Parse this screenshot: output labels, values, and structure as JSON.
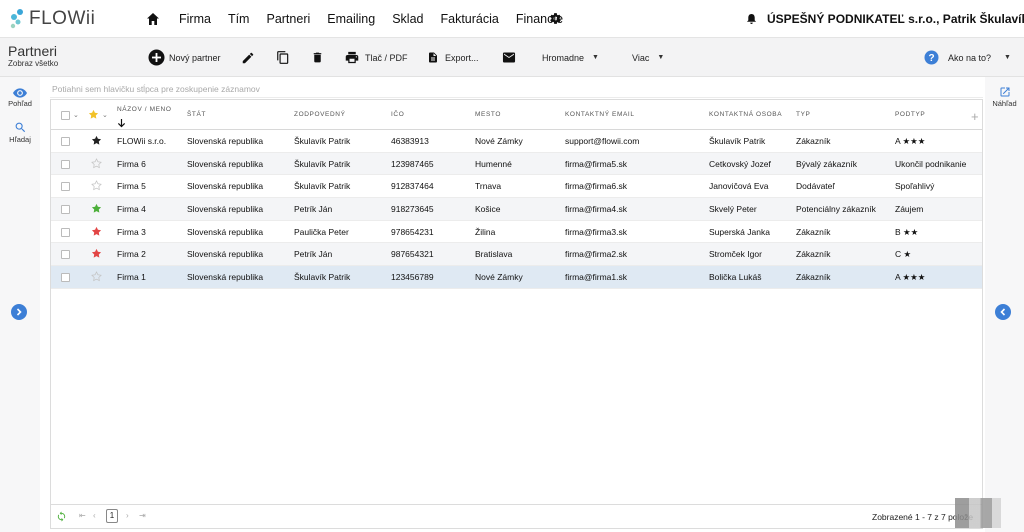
{
  "app": {
    "logo_text": "FLOWii"
  },
  "nav": {
    "items": [
      "Firma",
      "Tím",
      "Partneri",
      "Emailing",
      "Sklad",
      "Fakturácia",
      "Financie"
    ],
    "company": "ÚSPEŠNÝ PODNIKATEĽ s.r.o., Patrik Škulavík"
  },
  "page": {
    "title": "Partneri",
    "subtitle": "Zobraz všetko"
  },
  "toolbar": {
    "new_partner": "Nový partner",
    "print": "Tlač / PDF",
    "export": "Export...",
    "bulk": "Hromadne",
    "more": "Viac",
    "help": "Ako na to?"
  },
  "left_rail": {
    "view": "Pohľad",
    "search": "Hľadaj"
  },
  "right_rail": {
    "preview": "Náhľad"
  },
  "grid": {
    "group_hint": "Potiahni sem hlavičku stĺpca pre zoskupenie záznamov",
    "columns": [
      "NÁZOV / MENO",
      "ŠTÁT",
      "ZODPOVEDNÝ",
      "IČO",
      "MESTO",
      "KONTAKTNÝ EMAIL",
      "KONTAKTNÁ OSOBA",
      "TYP",
      "PODTYP"
    ],
    "rows": [
      {
        "star": "black",
        "name": "FLOWii s.r.o.",
        "state": "Slovenská republika",
        "owner": "Škulavík Patrik",
        "ico": "46383913",
        "city": "Nové Zámky",
        "email": "support@flowii.com",
        "contact": "Škulavík Patrik",
        "type": "Zákazník",
        "subtype": "A ★★★"
      },
      {
        "star": "none",
        "name": "Firma 6",
        "state": "Slovenská republika",
        "owner": "Škulavík Patrik",
        "ico": "123987465",
        "city": "Humenné",
        "email": "firma@firma5.sk",
        "contact": "Cetkovský Jozef",
        "type": "Bývalý zákazník",
        "subtype": "Ukončil podnikanie"
      },
      {
        "star": "none",
        "name": "Firma 5",
        "state": "Slovenská republika",
        "owner": "Škulavík Patrik",
        "ico": "912837464",
        "city": "Trnava",
        "email": "firma@firma6.sk",
        "contact": "Janovičová Eva",
        "type": "Dodávateľ",
        "subtype": "Spoľahlivý"
      },
      {
        "star": "green",
        "name": "Firma 4",
        "state": "Slovenská republika",
        "owner": "Petrík Ján",
        "ico": "918273645",
        "city": "Košice",
        "email": "firma@firma4.sk",
        "contact": "Skvelý Peter",
        "type": "Potenciálny zákazník",
        "subtype": "Záujem"
      },
      {
        "star": "red",
        "name": "Firma 3",
        "state": "Slovenská republika",
        "owner": "Paulička Peter",
        "ico": "978654231",
        "city": "Žilina",
        "email": "firma@firma3.sk",
        "contact": "Superská Janka",
        "type": "Zákazník",
        "subtype": "B ★★"
      },
      {
        "star": "red",
        "name": "Firma 2",
        "state": "Slovenská republika",
        "owner": "Petrík Ján",
        "ico": "987654321",
        "city": "Bratislava",
        "email": "firma@firma2.sk",
        "contact": "Stromček Igor",
        "type": "Zákazník",
        "subtype": "C ★"
      },
      {
        "star": "none",
        "name": "Firma 1",
        "state": "Slovenská republika",
        "owner": "Škulavík Patrik",
        "ico": "123456789",
        "city": "Nové Zámky",
        "email": "firma@firma1.sk",
        "contact": "Bolička Lukáš",
        "type": "Zákazník",
        "subtype": "A ★★★"
      }
    ]
  },
  "footer": {
    "page": "1",
    "status": "Zobrazené 1 - 7 z 7 polože"
  },
  "colors": {
    "accent": "#3d7fd6",
    "star_gold": "#f2c229",
    "star_green": "#4caf3a",
    "star_red": "#e24545",
    "selected_row": "#dfe9f3"
  }
}
